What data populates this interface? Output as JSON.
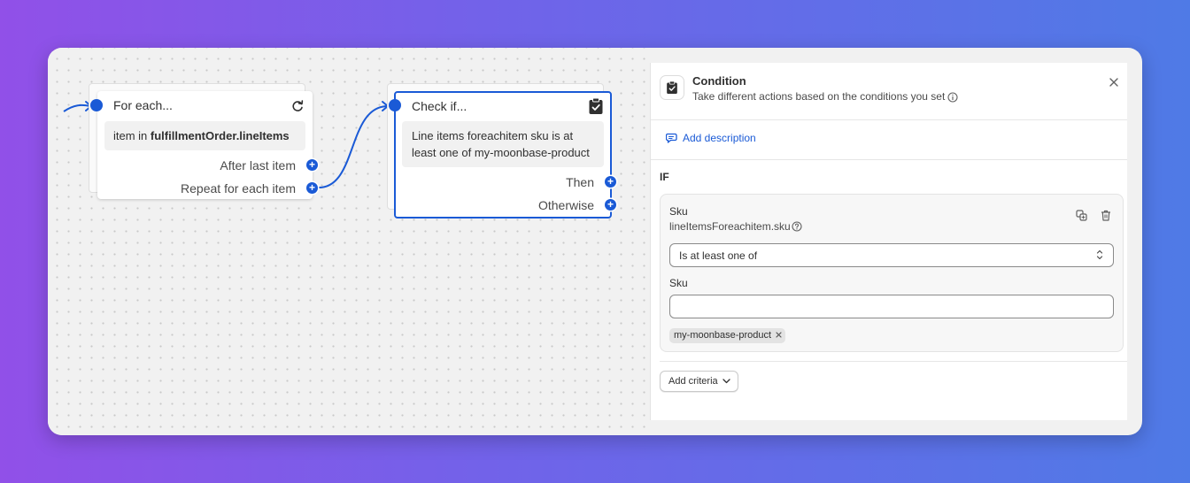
{
  "canvas": {
    "foreach_node": {
      "title": "For each...",
      "body_prefix": "item in ",
      "body_bold": "fulfillmentOrder.lineItems",
      "outputs": [
        "After last item",
        "Repeat for each item"
      ]
    },
    "condition_node": {
      "title": "Check if...",
      "body_line1": "Line items foreachitem sku is at",
      "body_line2": "least one of my-moonbase-product",
      "outputs": [
        "Then",
        "Otherwise"
      ]
    }
  },
  "panel": {
    "title": "Condition",
    "subtitle": "Take different actions based on the conditions you set",
    "add_description": "Add description",
    "if_label": "IF",
    "criterion": {
      "title": "Sku",
      "path": "lineItemsForeachitem.sku",
      "operator": "Is at least one of",
      "value_label": "Sku",
      "input_value": "",
      "tags": [
        "my-moonbase-product"
      ]
    },
    "add_criteria": "Add criteria"
  },
  "colors": {
    "accent": "#1a5ad6",
    "background_gradient_start": "#9150e8",
    "background_gradient_end": "#4f7ae6"
  },
  "icons": {
    "foreach": "loop-arrow-icon",
    "condition": "clipboard-check-icon",
    "close": "close-icon",
    "info": "info-icon",
    "help": "question-circle-icon",
    "duplicate": "duplicate-icon",
    "delete": "trash-icon",
    "add_description": "comment-edit-icon",
    "select": "chevron-up-down-icon",
    "add_criteria": "chevron-down-icon"
  }
}
